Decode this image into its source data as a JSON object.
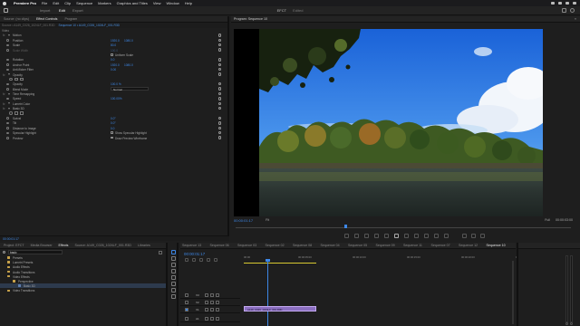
{
  "menubar": {
    "app": "Premiere Pro",
    "items": [
      "File",
      "Edit",
      "Clip",
      "Sequence",
      "Markers",
      "Graphics and Titles",
      "View",
      "Window",
      "Help"
    ]
  },
  "header": {
    "modes": [
      "Import",
      "Edit",
      "Export"
    ],
    "active_mode": "Edit",
    "project_title": "EFCT",
    "project_status": "Edited"
  },
  "effect_controls": {
    "tabs": [
      "Source: (no clips)",
      "Effect Controls",
      "Program"
    ],
    "source_label": "Source • A149_C026_1024LF_001.R3D",
    "sequence_label": "Sequence 10 • A149_C026_1024LF_001.R3D",
    "video_label": "Video",
    "properties": [
      {
        "label": "Motion",
        "type": "group",
        "indent": 3
      },
      {
        "label": "Position",
        "v1": "1920.0",
        "v2": "1080.0",
        "indent": 11
      },
      {
        "label": "Scale",
        "v1": "80.0",
        "indent": 11
      },
      {
        "label": "Scale Width",
        "v1": "100.0",
        "indent": 11,
        "dim": true
      },
      {
        "label": "",
        "check": "Uniform Scale",
        "indent": 11
      },
      {
        "label": "Rotation",
        "v1": "0.0",
        "indent": 11
      },
      {
        "label": "Anchor Point",
        "v1": "1920.0",
        "v2": "1080.0",
        "indent": 11
      },
      {
        "label": "Anti-flicker Filter",
        "v1": "0.00",
        "indent": 11
      },
      {
        "label": "Opacity",
        "type": "group",
        "indent": 3
      },
      {
        "label": "",
        "type": "masks",
        "indent": 11
      },
      {
        "label": "Opacity",
        "v1": "100.0 %",
        "indent": 11
      },
      {
        "label": "Blend Mode",
        "dd": "Normal",
        "indent": 11
      },
      {
        "label": "Time Remapping",
        "type": "group",
        "indent": 3
      },
      {
        "label": "Speed",
        "v1": "100.00%",
        "indent": 11
      },
      {
        "label": "Lumetri Color",
        "type": "group",
        "indent": 3
      },
      {
        "label": "Basic 3D",
        "type": "group",
        "indent": 3
      },
      {
        "label": "",
        "type": "masks",
        "indent": 11
      },
      {
        "label": "Swivel",
        "v1": "0.0°",
        "indent": 11
      },
      {
        "label": "Tilt",
        "v1": "0.0°",
        "indent": 11
      },
      {
        "label": "Distance to Image",
        "v1": "0.0",
        "indent": 11
      },
      {
        "label": "Specular Highlight",
        "check": "Show Specular Highlight",
        "indent": 11
      },
      {
        "label": "Preview",
        "check": "Draw Preview Wireframe",
        "indent": 11
      }
    ],
    "footer_timecode": "00:00:01:17"
  },
  "program": {
    "title": "Program: Sequence 10",
    "timecode": "00:00:01:17",
    "fit": "Fit",
    "quality": "Full",
    "duration": "00:00:03:00"
  },
  "project": {
    "tabs": [
      "Project: EFCT",
      "Media Browser",
      "Effects",
      "Source: A149_C026_1024LF_001.R3D",
      "Libraries"
    ],
    "active_tab": "Effects",
    "search_value": "basic",
    "items": [
      {
        "label": "Presets",
        "indent": 6
      },
      {
        "label": "Lumetri Presets",
        "indent": 6
      },
      {
        "label": "Audio Effects",
        "indent": 6
      },
      {
        "label": "Audio Transitions",
        "indent": 6
      },
      {
        "label": "Video Effects",
        "indent": 6
      },
      {
        "label": "Perspective",
        "indent": 12
      },
      {
        "label": "Basic 3D",
        "indent": 18,
        "selected": true
      },
      {
        "label": "Video Transitions",
        "indent": 6
      }
    ]
  },
  "timeline": {
    "tabs": [
      "Sequence 13",
      "Sequence 06",
      "Sequence 03",
      "Sequence 02",
      "Sequence 08",
      "Sequence 04",
      "Sequence 05",
      "Sequence 09",
      "Sequence 11",
      "Sequence 07",
      "Sequence 12",
      "Sequence 10"
    ],
    "active_tab": "Sequence 10",
    "timecode": "00:00:01:17",
    "ruler": [
      "00:00",
      "00:00:05:00",
      "00:00:10:00",
      "00:00:15:00",
      "00:00:20:00",
      "00:00:25:00"
    ],
    "tracks": [
      "V3",
      "V2",
      "V1",
      "A1"
    ],
    "clip_label": "A149_C026_1024LF_001.R3D"
  },
  "colors": {
    "accent": "#3d87e6",
    "clip": "#8b6fc0",
    "folder": "#c8a24a"
  }
}
